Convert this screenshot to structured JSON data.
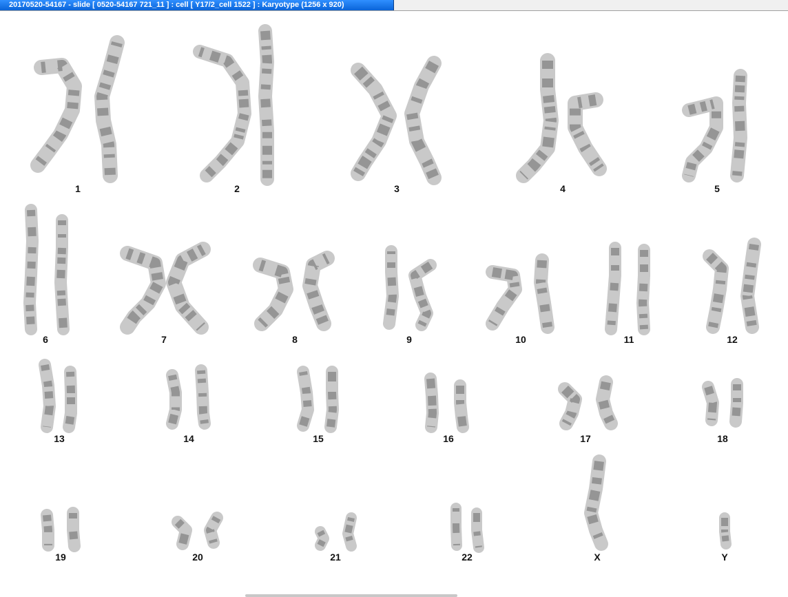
{
  "window": {
    "title": "20170520-54167 - slide [ 0520-54167 721_11 ] : cell [ Y17/2_cell 1522 ] : Karyotype  (1256 x 920)"
  },
  "karyotype": {
    "labels": [
      "1",
      "2",
      "3",
      "4",
      "5",
      "6",
      "7",
      "8",
      "9",
      "10",
      "11",
      "12",
      "13",
      "14",
      "15",
      "16",
      "17",
      "18",
      "19",
      "20",
      "21",
      "22",
      "X",
      "Y"
    ]
  },
  "colors": {
    "chromosome_fill": "#c9c9c9",
    "band_dark": "#6a6a6a",
    "title_bar": "#0a64d8"
  }
}
